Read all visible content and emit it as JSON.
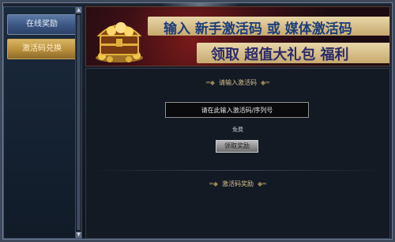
{
  "sidebar": {
    "items": [
      {
        "label": "在线奖励",
        "active": false
      },
      {
        "label": "激活码兑换",
        "active": true
      }
    ]
  },
  "banner": {
    "line1": "输入 新手激活码 或 媒体激活码",
    "line2": "领取 超值大礼包 福利"
  },
  "main": {
    "input_section_title": "请输入激活码",
    "code_input_placeholder": "请在此输入激活码/序列号",
    "free_label": "免费",
    "redeem_button_label": "领取奖励",
    "reward_section_title": "激活码奖励"
  },
  "icons": {
    "chest": "treasure-chest-icon",
    "scroll_up": "arrow-up-icon",
    "scroll_down": "arrow-down-icon"
  },
  "colors": {
    "gold_text": "#d7c18e",
    "active_tab": "#b88e3a",
    "inactive_tab": "#3a5581"
  }
}
